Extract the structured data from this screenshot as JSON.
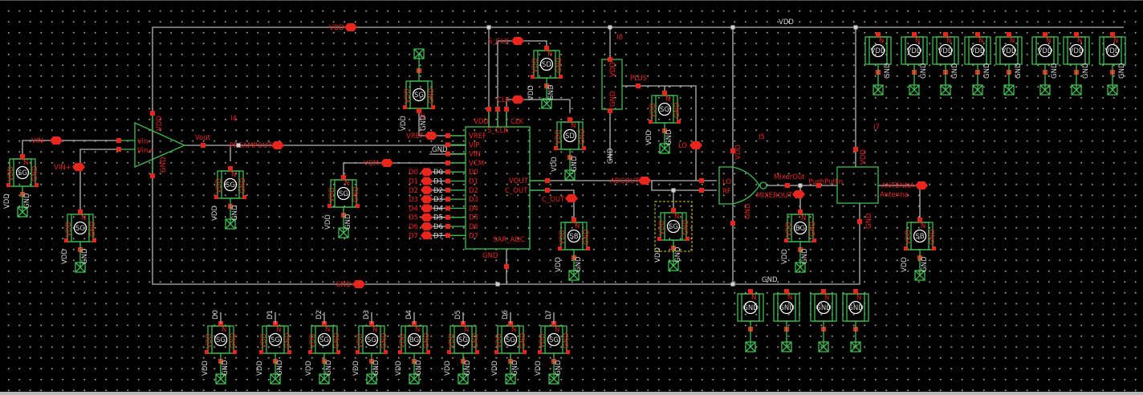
{
  "colors": {
    "background": "#000000",
    "wire": "#b4b4b4",
    "symbol": "#3fbf4f",
    "pin": "#e8261e",
    "label": "#e8261e"
  },
  "nets": {
    "vdd_rail": "VDD",
    "vdd_pin": "VDD",
    "gnd_rail": "GND",
    "gnd_pin": "GND",
    "vin_minus": "VIN-",
    "vin_plus": "VIN+",
    "preampout": "PREAMPOUT",
    "vcm": "VCM",
    "vref": "VREF",
    "s_clk": "S_CLK",
    "clk": "CLK",
    "plus": "PLUS",
    "lo": "LO",
    "adcout": "ADCOUT",
    "c_out": "C_OUT",
    "mixerout": "MIXEROUT",
    "mixer_wire": "MixerOut",
    "antenna": "ANTENNA",
    "vip_gnd": "GND"
  },
  "opamp": {
    "instance": "I4",
    "vin_minus": "Vin-",
    "vin_plus": "Vin+",
    "vout": "Vout",
    "vdd": "VDD",
    "gnd": "GND"
  },
  "adc": {
    "name": "SAR_ADC",
    "left_pins": [
      "VREF",
      "VIP",
      "VIN",
      "VCM",
      "D0",
      "D1",
      "D2",
      "D3",
      "D4",
      "D5",
      "D6",
      "D7"
    ],
    "top_pins": [
      "VDD",
      "S_CLK",
      "CLK"
    ],
    "right_pins": [
      "VOUT",
      "C_OUT"
    ],
    "bottom_pin": "GND",
    "bus_pins": [
      "D0",
      "D1",
      "D2",
      "D3",
      "D4",
      "D5",
      "D6",
      "D7"
    ],
    "bus_wires": [
      "D0",
      "D1",
      "D2",
      "D3",
      "D4",
      "D5",
      "D6",
      "D7"
    ]
  },
  "clock": {
    "instance": "I8",
    "vdd": "VDD",
    "gnd": "GND",
    "gnd_wire": "GND"
  },
  "mixer": {
    "instance": "I5",
    "lo": "LO",
    "rf": "RF",
    "vdd": "VDD",
    "gnd": "GND"
  },
  "pushpull": {
    "instance": "I7",
    "in": "PushPullIn",
    "out": "Antenna",
    "vdd": "VDD",
    "gnd": "GND"
  },
  "probe_text": {
    "n": "N",
    "vdd": "VDD",
    "gnd": "GND"
  },
  "probes": {
    "vin": "SG",
    "vinp": "SG",
    "preamp": "SG",
    "vcm": "SG",
    "vref": "SG",
    "s_clk": "SD",
    "clk": "SD",
    "plus": "SG",
    "c_out": "SB",
    "adcout": "SG",
    "mixer": "BG",
    "antenna": "SB",
    "bits": [
      "SG",
      "SG",
      "SG",
      "SG",
      "BG",
      "SG",
      "SG",
      "SG"
    ],
    "bit_labels": [
      "D0",
      "D1",
      "D2",
      "D3",
      "D4",
      "D5",
      "D6",
      "D7"
    ],
    "vdd_sources": [
      "VDD",
      "VDD",
      "VDD",
      "VDD",
      "VDD",
      "VDD",
      "VDD",
      "VDD"
    ],
    "gnd_sources": [
      "GND",
      "GND",
      "GND",
      "GND"
    ]
  }
}
